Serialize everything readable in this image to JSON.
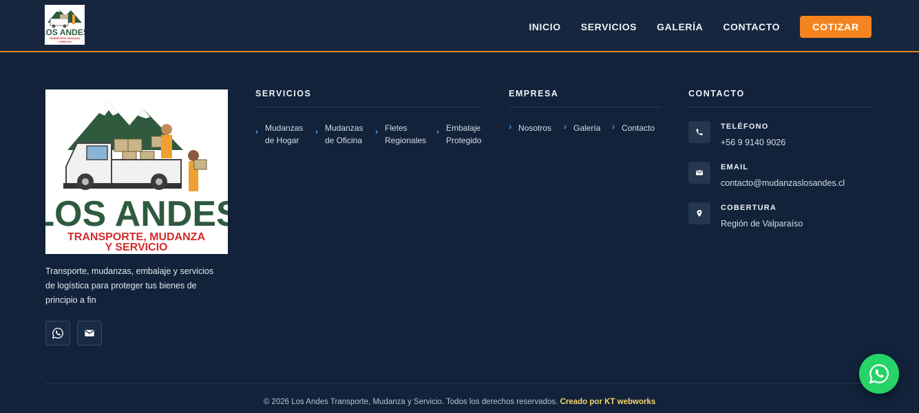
{
  "brand": {
    "logo_title": "LOS ANDES",
    "logo_subtitle_line1": "TRANSPORTE, MUDANZA",
    "logo_subtitle_line2": "Y SERVICIO"
  },
  "nav": {
    "items": [
      "INICIO",
      "SERVICIOS",
      "GALERÍA",
      "CONTACTO"
    ],
    "cta": "COTIZAR"
  },
  "about": {
    "tagline": "Transporte, mudanzas, embalaje y servicios de logística para proteger tus bienes de principio a fin"
  },
  "services": {
    "title": "SERVICIOS",
    "items": [
      {
        "line1": "Mudanzas",
        "line2": "de Hogar"
      },
      {
        "line1": "Mudanzas",
        "line2": "de Oficina"
      },
      {
        "line1": "Fletes",
        "line2": "Regionales"
      },
      {
        "line1": "Embalaje",
        "line2": "Protegido"
      }
    ]
  },
  "company": {
    "title": "EMPRESA",
    "items": [
      "Nosotros",
      "Galería",
      "Contacto"
    ]
  },
  "contact": {
    "title": "CONTACTO",
    "phone_label": "TELÉFONO",
    "phone_value": "+56 9 9140 9026",
    "email_label": "EMAIL",
    "email_value": "contacto@mudanzaslosandes.cl",
    "coverage_label": "COBERTURA",
    "coverage_value": "Región de Valparaíso"
  },
  "footer": {
    "copyright": "© 2026 Los Andes Transporte, Mudanza y Servicio. Todos los derechos reservados.",
    "credit": "Creado por KT webworks"
  },
  "colors": {
    "background": "#11223a",
    "header": "#16263e",
    "accent": "#f5841f",
    "link_chevron": "#4ea3ff",
    "whatsapp": "#25d366"
  },
  "icons": {
    "social": [
      "whatsapp-icon",
      "mail-icon"
    ],
    "contact": [
      "phone-icon",
      "mail-icon",
      "location-pin-icon"
    ]
  }
}
